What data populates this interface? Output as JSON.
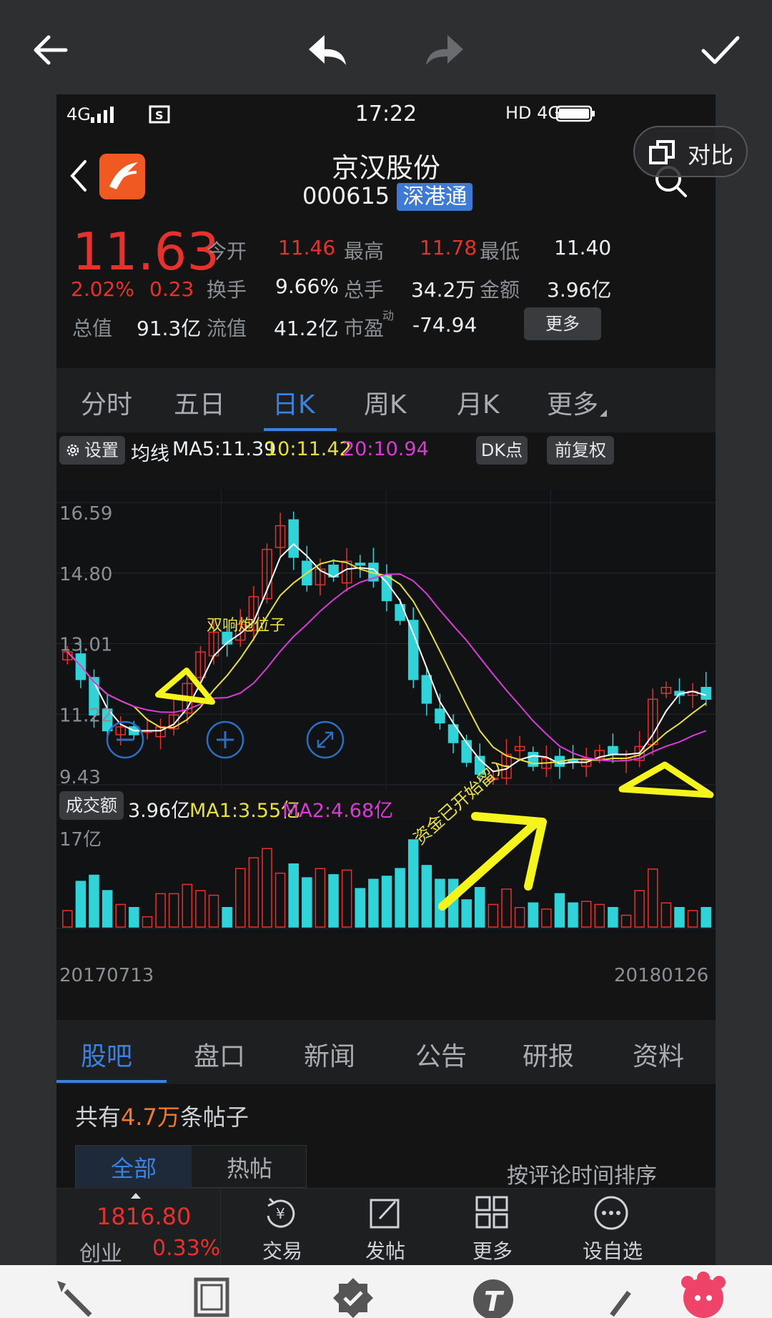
{
  "editor": {
    "back_icon": "arrow-left-icon",
    "undo_icon": "undo-icon",
    "redo_icon": "redo-icon",
    "confirm_icon": "check-icon"
  },
  "status_bar": {
    "network": "4G",
    "time": "17:22",
    "right": "HD 4G"
  },
  "compare_button": "对比",
  "stock": {
    "name": "京汉股份",
    "code": "000615",
    "badge": "深港通"
  },
  "quote": {
    "price": "11.63",
    "change_pct": "2.02%",
    "change": "0.23",
    "total_value_label": "总值",
    "total_value": "91.3亿",
    "fields": [
      {
        "label": "今开",
        "value": "11.46",
        "color": "#e8312c"
      },
      {
        "label": "最高",
        "value": "11.78",
        "color": "#e8312c"
      },
      {
        "label": "最低",
        "value": "11.40",
        "color": "#eceff2"
      },
      {
        "label": "换手",
        "value": "9.66%",
        "color": "#eceff2"
      },
      {
        "label": "总手",
        "value": "34.2万",
        "color": "#eceff2"
      },
      {
        "label": "金额",
        "value": "3.96亿",
        "color": "#eceff2"
      },
      {
        "label": "流值",
        "value": "41.2亿",
        "color": "#eceff2"
      },
      {
        "label": "市盈",
        "value": "-74.94",
        "color": "#eceff2"
      }
    ],
    "pe_superscript": "动",
    "more_button": "更多"
  },
  "chart_tabs": [
    "分时",
    "五日",
    "日K",
    "周K",
    "月K",
    "更多"
  ],
  "active_chart_tab": "日K",
  "ma_bar": {
    "settings": "设置",
    "label": "均线",
    "ma5": "MA5:11.39",
    "ma10": "10:11.42",
    "ma20": "20:10.94",
    "dk_button": "DK点",
    "adjust_button": "前复权"
  },
  "price_axis": [
    "16.59",
    "14.80",
    "13.01",
    "11.22",
    "9.43"
  ],
  "annotations": {
    "double_cannon": "双响炮位子",
    "funds_inflow": "资金已开始留入"
  },
  "volume_bar": {
    "label": "成交额",
    "value": "3.96亿",
    "ma1": "MA1:3.55亿",
    "ma2": "MA2:4.68亿",
    "axis_max": "17亿"
  },
  "dates": {
    "start": "20170713",
    "end": "20180126"
  },
  "bottom_tabs": [
    "股吧",
    "盘口",
    "新闻",
    "公告",
    "研报",
    "资料"
  ],
  "active_bottom_tab": "股吧",
  "posts": {
    "prefix": "共有",
    "count": "4.7万",
    "suffix": "条帖子",
    "filter_all": "全部",
    "filter_hot": "热帖",
    "sort": "按评论时间排序"
  },
  "footer": {
    "index_value": "1816.80",
    "index_name": "创业",
    "index_change": "0.33%",
    "items": [
      "交易",
      "发帖",
      "更多",
      "设自选"
    ]
  },
  "colors": {
    "up": "#e8312c",
    "down": "#2fd3d8",
    "ma5": "#ffffff",
    "ma10": "#e6e03a",
    "ma20": "#d93bd6",
    "accent": "#3b82e0",
    "marker": "#f5f51c"
  },
  "chart_data": {
    "type": "candlestick",
    "ylim": [
      9.43,
      16.59
    ],
    "y_ticks": [
      16.59,
      14.8,
      13.01,
      11.22,
      9.43
    ],
    "x_range": [
      "20170713",
      "20180126"
    ],
    "close_series_approx": [
      12.8,
      12.1,
      11.2,
      10.8,
      10.9,
      10.7,
      10.8,
      10.9,
      11.2,
      12.0,
      12.8,
      13.3,
      13.0,
      13.5,
      14.2,
      15.4,
      16.0,
      15.2,
      14.5,
      14.9,
      14.7,
      15.1,
      15.0,
      14.6,
      14.1,
      13.6,
      12.1,
      11.5,
      11.0,
      10.5,
      10.0,
      9.7,
      9.6,
      10.2,
      10.4,
      9.9,
      10.1,
      9.9,
      10.0,
      10.1,
      10.3,
      10.2,
      10.1,
      10.4,
      11.6,
      11.9,
      11.7,
      11.8,
      11.6
    ],
    "volume_ylim": [
      0,
      17
    ],
    "volume_unit": "亿",
    "series_names": [
      "MA5",
      "10",
      "20"
    ]
  }
}
